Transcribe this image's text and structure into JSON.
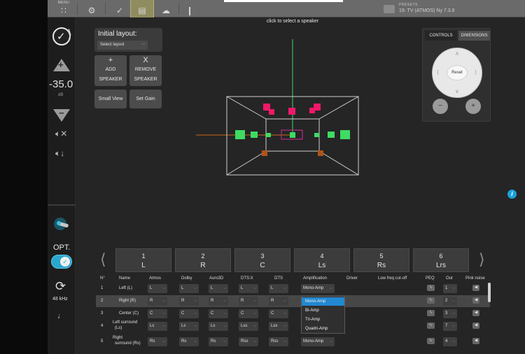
{
  "toolbar": {
    "menu_label": "MENU",
    "presets_label": "PRESETS",
    "preset_value": "19. TV (ATMOS) Ny 7.3.6"
  },
  "sidebar": {
    "volume_value": "-35.0",
    "volume_unit": "dB",
    "input_label": "OPT.",
    "sample_rate": "48 kHz"
  },
  "main": {
    "hint": "click to select a speaker",
    "initial_layout": {
      "title": "Initial layout:",
      "select_placeholder": "Select layout"
    },
    "buttons": {
      "add_glyph": "+",
      "add_l1": "ADD",
      "add_l2": "SPEAKER",
      "remove_glyph": "X",
      "remove_l1": "REMOVE",
      "remove_l2": "SPEAKER",
      "small_view": "Small View",
      "set_gain": "Set Gain"
    },
    "controls": {
      "tab_controls": "CONTROLS",
      "tab_dimensions": "DIMENSIONS",
      "reset": "Reset"
    }
  },
  "strip": [
    {
      "num": "1",
      "code": "L"
    },
    {
      "num": "2",
      "code": "R"
    },
    {
      "num": "3",
      "code": "C"
    },
    {
      "num": "4",
      "code": "Ls"
    },
    {
      "num": "5",
      "code": "Rs"
    },
    {
      "num": "6",
      "code": "Lrs"
    }
  ],
  "table": {
    "headers": {
      "n": "N°",
      "name": "Name",
      "atmos": "Atmos",
      "dolby": "Dolby",
      "auro": "Auro3D",
      "dtsx": "DTS:X",
      "dts": "DTS",
      "amp": "Amplification",
      "driver": "Driver",
      "lowfreq": "Low freq cut-off",
      "peq": "PEQ",
      "out": "Out",
      "pink": "Pink noise"
    },
    "rows": [
      {
        "n": "1",
        "name": "Left (L)",
        "atmos": "L",
        "dolby": "L",
        "auro": "L",
        "dtsx": "L",
        "dts": "L",
        "amp": "Mono-Amp",
        "out": "1"
      },
      {
        "n": "2",
        "name": "Right (R)",
        "atmos": "R",
        "dolby": "R",
        "auro": "R",
        "dtsx": "R",
        "dts": "R",
        "amp": "Mono-Amp",
        "out": "2"
      },
      {
        "n": "3",
        "name": "Center (C)",
        "atmos": "C",
        "dolby": "C",
        "auro": "C",
        "dtsx": "C",
        "dts": "C",
        "amp": "",
        "out": "3"
      },
      {
        "n": "4",
        "name1": "Left surround",
        "name2": "(Ls)",
        "atmos": "Ls",
        "dolby": "Ls",
        "auro": "Ls",
        "dtsx": "Lss",
        "dts": "Lss",
        "amp": "",
        "out": "7"
      },
      {
        "n": "5",
        "name1": "Right",
        "name2": "surround (Rs)",
        "atmos": "Rs",
        "dolby": "Rs",
        "auro": "Rs",
        "dtsx": "Rss",
        "dts": "Rss",
        "amp": "Mono-Amp",
        "out": "4"
      }
    ],
    "amp_options": [
      "Mono-Amp",
      "Bi-Amp",
      "Tri-Amp",
      "Quadri-Amp"
    ]
  },
  "colors": {
    "accent": "#2288d0",
    "front_speaker": "#3ddc62",
    "height_speaker": "#f0186a",
    "surround_rear": "#b0541a"
  }
}
